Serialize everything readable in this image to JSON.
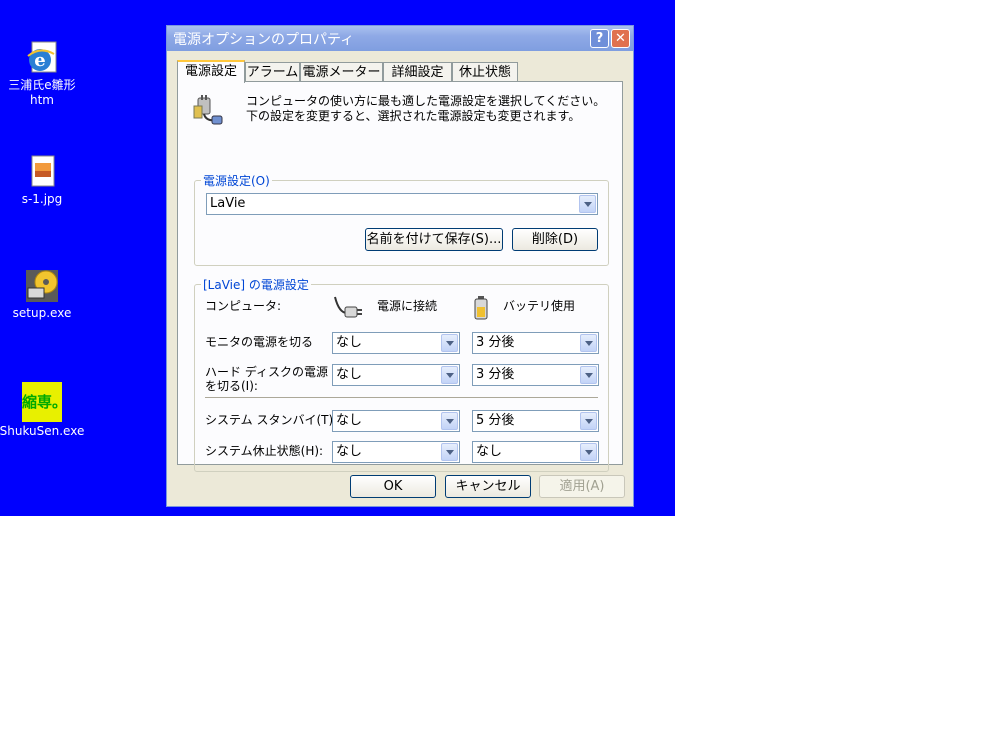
{
  "desktop": {
    "icons": [
      {
        "name": "ie-html-icon",
        "label_line1": "三浦氏e雛形",
        "label_line2": "htm"
      },
      {
        "name": "jpg-file-icon",
        "label_line1": "s-1.jpg",
        "label_line2": ""
      },
      {
        "name": "setup-exe-icon",
        "label_line1": "setup.exe",
        "label_line2": ""
      },
      {
        "name": "shukusen-icon",
        "label_line1": "ShukuSen.exe",
        "label_line2": "",
        "glyph_text": "縮専。"
      }
    ]
  },
  "window": {
    "title": "電源オプションのプロパティ",
    "help_label": "?",
    "close_label": "✕",
    "tabs": [
      "電源設定",
      "アラーム",
      "電源メーター",
      "詳細設定",
      "休止状態"
    ],
    "active_tab": "電源設定",
    "intro_text": "コンピュータの使い方に最も適した電源設定を選択してください。下の設定を変更すると、選択された電源設定も変更されます。",
    "scheme_group": {
      "legend": "電源設定(O)",
      "selected": "LaVie",
      "save_as_label": "名前を付けて保存(S)...",
      "delete_label": "削除(D)"
    },
    "settings_group": {
      "legend": "[LaVie] の電源設定",
      "computer_label": "コンピュータ:",
      "ac_label": "電源に接続",
      "battery_label": "バッテリ使用",
      "rows": [
        {
          "label": "モニタの電源を切る",
          "ac": "なし",
          "dc": "3 分後"
        },
        {
          "label": "ハード ディスクの電源を切る(I):",
          "ac": "なし",
          "dc": "3 分後"
        },
        {
          "label": "システム スタンバイ(T):",
          "ac": "なし",
          "dc": "5 分後"
        },
        {
          "label": "システム休止状態(H):",
          "ac": "なし",
          "dc": "なし"
        }
      ]
    },
    "ok_label": "OK",
    "cancel_label": "キャンセル",
    "apply_label": "適用(A)"
  },
  "colors": {
    "desktop": "#0000fe",
    "titlebar": "#8fa9e6",
    "dialog": "#ece9d8",
    "legend": "#0046d5"
  }
}
